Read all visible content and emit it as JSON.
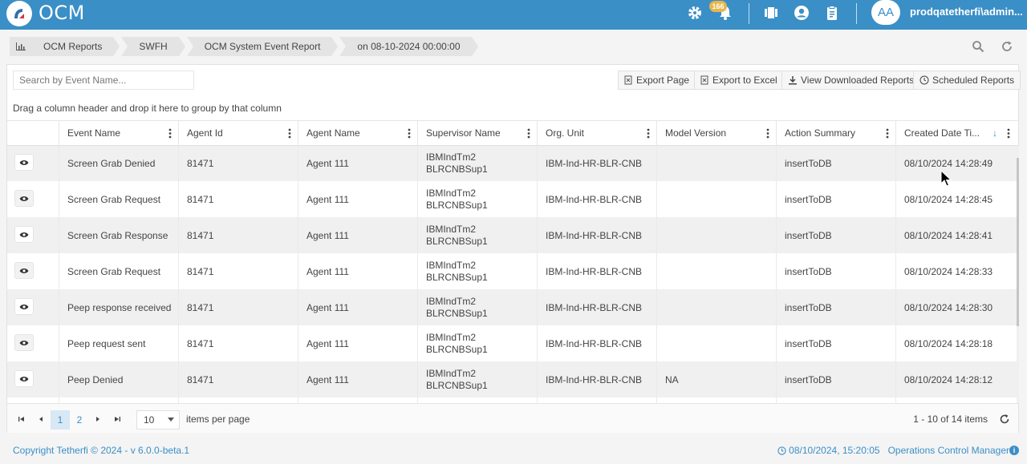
{
  "app": {
    "title": "OCM",
    "notification_count": "166",
    "avatar_initials": "AA",
    "username": "prodqatetherfi\\admin..."
  },
  "breadcrumb": [
    "OCM Reports",
    "SWFH",
    "OCM System Event Report",
    "on 08-10-2024 00:00:00"
  ],
  "toolbar": {
    "search_placeholder": "Search by Event Name...",
    "export_page": "Export Page",
    "export_excel": "Export to Excel",
    "view_downloaded": "View Downloaded Reports",
    "scheduled_reports": "Scheduled Reports"
  },
  "group_hint": "Drag a column header and drop it here to group by that column",
  "columns": [
    "Event Name",
    "Agent Id",
    "Agent Name",
    "Supervisor Name",
    "Org. Unit",
    "Model Version",
    "Action Summary",
    "Created Date Ti..."
  ],
  "rows": [
    {
      "event": "Screen Grab Denied",
      "agent_id": "81471",
      "agent_name": "Agent 111",
      "sup1": "IBMIndTm2",
      "sup2": "BLRCNBSup1",
      "org": "IBM-Ind-HR-BLR-CNB",
      "model": "",
      "action": "insertToDB",
      "created": "08/10/2024 14:28:49"
    },
    {
      "event": "Screen Grab Request",
      "agent_id": "81471",
      "agent_name": "Agent 111",
      "sup1": "IBMIndTm2",
      "sup2": "BLRCNBSup1",
      "org": "IBM-Ind-HR-BLR-CNB",
      "model": "",
      "action": "insertToDB",
      "created": "08/10/2024 14:28:45"
    },
    {
      "event": "Screen Grab Response",
      "agent_id": "81471",
      "agent_name": "Agent 111",
      "sup1": "IBMIndTm2",
      "sup2": "BLRCNBSup1",
      "org": "IBM-Ind-HR-BLR-CNB",
      "model": "",
      "action": "insertToDB",
      "created": "08/10/2024 14:28:41"
    },
    {
      "event": "Screen Grab Request",
      "agent_id": "81471",
      "agent_name": "Agent 111",
      "sup1": "IBMIndTm2",
      "sup2": "BLRCNBSup1",
      "org": "IBM-Ind-HR-BLR-CNB",
      "model": "",
      "action": "insertToDB",
      "created": "08/10/2024 14:28:33"
    },
    {
      "event": "Peep response received",
      "agent_id": "81471",
      "agent_name": "Agent 111",
      "sup1": "IBMIndTm2",
      "sup2": "BLRCNBSup1",
      "org": "IBM-Ind-HR-BLR-CNB",
      "model": "",
      "action": "insertToDB",
      "created": "08/10/2024 14:28:30"
    },
    {
      "event": "Peep request sent",
      "agent_id": "81471",
      "agent_name": "Agent 111",
      "sup1": "IBMIndTm2",
      "sup2": "BLRCNBSup1",
      "org": "IBM-Ind-HR-BLR-CNB",
      "model": "",
      "action": "insertToDB",
      "created": "08/10/2024 14:28:18"
    },
    {
      "event": "Peep Denied",
      "agent_id": "81471",
      "agent_name": "Agent 111",
      "sup1": "IBMIndTm2",
      "sup2": "BLRCNBSup1",
      "org": "IBM-Ind-HR-BLR-CNB",
      "model": "NA",
      "action": "insertToDB",
      "created": "08/10/2024 14:28:12"
    }
  ],
  "pager": {
    "pages": [
      "1",
      "2"
    ],
    "page_size": "10",
    "items_per_page_label": "items per page",
    "info": "1 - 10 of 14 items"
  },
  "footer": {
    "copyright": "Copyright Tetherfi © 2024 - v 6.0.0-beta.1",
    "datetime": "08/10/2024, 15:20:05",
    "product": "Operations Control Manager",
    "info_glyph": "i"
  },
  "colors": {
    "accent": "#3a8fc7",
    "badge": "#e8b64c"
  }
}
